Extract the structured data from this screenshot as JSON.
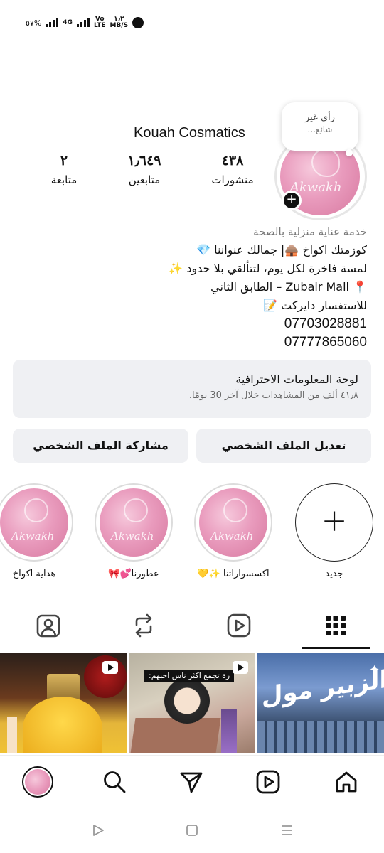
{
  "status_bar": {
    "battery": "٥٧%",
    "network_label": "4G",
    "volte_label": "Vo\nLTE",
    "speed_value": "١٫٢",
    "speed_unit": "MB/S",
    "icons": [
      "signal-icon",
      "signal-4g-icon",
      "volte-icon",
      "alarm-icon"
    ]
  },
  "profile": {
    "username": "Kouah Cosmatics",
    "avatar_logo_text": "Akwakh",
    "note": {
      "line1": "رأي غير",
      "line2": "شائع..."
    },
    "stats": {
      "posts_count": "٤٣٨",
      "posts_label": "منشورات",
      "followers_count": "١٫٦٤٩",
      "followers_label": "متابعين",
      "following_count": "٢",
      "following_label": "متابعة"
    },
    "bio": {
      "category": "خدمة عناية منزلية بالصحة",
      "line1": "كوزمتك اكواخ 🛖| جمالك عنواننا 💎",
      "line2": "لمسة فاخرة لكل يوم، لتتألقي بلا حدود ✨",
      "line3": "📍 Zubair Mall – الطابق الثاني",
      "line4": "للاستفسار دايركت 📝",
      "phone1": "07703028881",
      "phone2": "07777865060"
    }
  },
  "dashboard": {
    "title": "لوحة المعلومات الاحترافية",
    "subtitle": "٤١٫٨ ألف من المشاهدات خلال آخر 30 يومًا."
  },
  "buttons": {
    "edit_profile": "تعديل الملف الشخصي",
    "share_profile": "مشاركة الملف الشخصي"
  },
  "highlights": [
    {
      "label": "جديد",
      "type": "new"
    },
    {
      "label": "اكسسواراتنا ✨💛",
      "type": "story"
    },
    {
      "label": "عطورنا💕🎀",
      "type": "story"
    },
    {
      "label": "هداية اكواخ",
      "type": "story"
    }
  ],
  "highlight_logo_text": "Akwakh",
  "tabs": {
    "items": [
      "grid-icon",
      "reels-icon",
      "reposts-icon",
      "tagged-icon"
    ],
    "active": "grid-icon"
  },
  "grid_posts": [
    {
      "type": "reel",
      "caption": ""
    },
    {
      "type": "reel",
      "caption": "رة تجمع اكثر ناس احبهم:"
    },
    {
      "type": "pinned",
      "caption": "الزبير مول"
    }
  ],
  "bottom_nav": {
    "items": [
      "home-icon",
      "reels-icon",
      "send-icon",
      "search-icon",
      "profile-avatar"
    ]
  },
  "colors": {
    "accent_pink": "#e99bbd",
    "button_bg": "#eff0f3",
    "text_primary": "#111111",
    "text_secondary": "#777777"
  }
}
